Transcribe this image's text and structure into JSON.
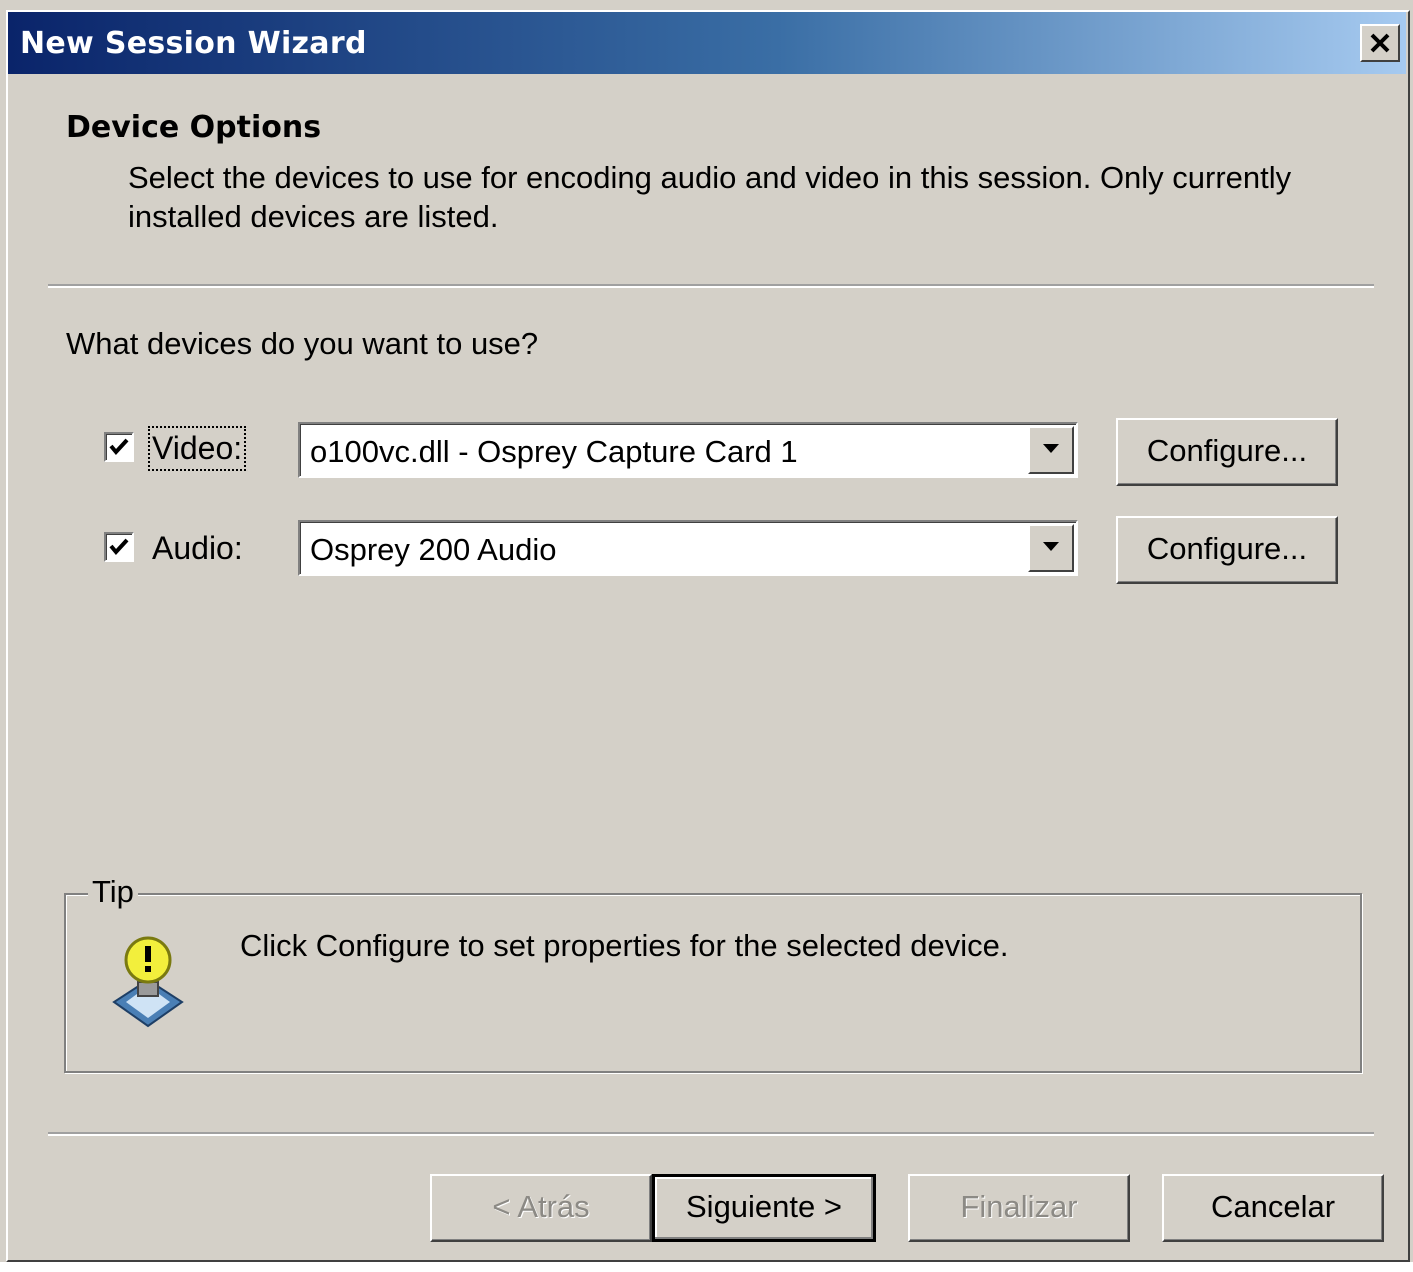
{
  "window": {
    "title": "New Session Wizard",
    "close_glyph": "✕"
  },
  "header": {
    "title": "Device Options",
    "description": "Select the devices to use for encoding audio and video in this session. Only currently installed devices are listed."
  },
  "question": "What devices do you want to use?",
  "devices": {
    "video": {
      "checked": true,
      "label": "Video:",
      "selected": "o100vc.dll - Osprey Capture Card 1",
      "configure_label": "Configure..."
    },
    "audio": {
      "checked": true,
      "label": "Audio:",
      "selected": "Osprey 200 Audio",
      "configure_label": "Configure..."
    }
  },
  "tip": {
    "legend": "Tip",
    "text": "Click Configure to set properties for the selected device.",
    "icon": "lightbulb-icon"
  },
  "footer": {
    "back_label": "< Atrás",
    "next_label": "Siguiente >",
    "finish_label": "Finalizar",
    "cancel_label": "Cancelar"
  },
  "colors": {
    "title_gradient_start": "#0a246a",
    "title_gradient_end": "#a6caf0",
    "dialog_face": "#d4d0c8"
  }
}
